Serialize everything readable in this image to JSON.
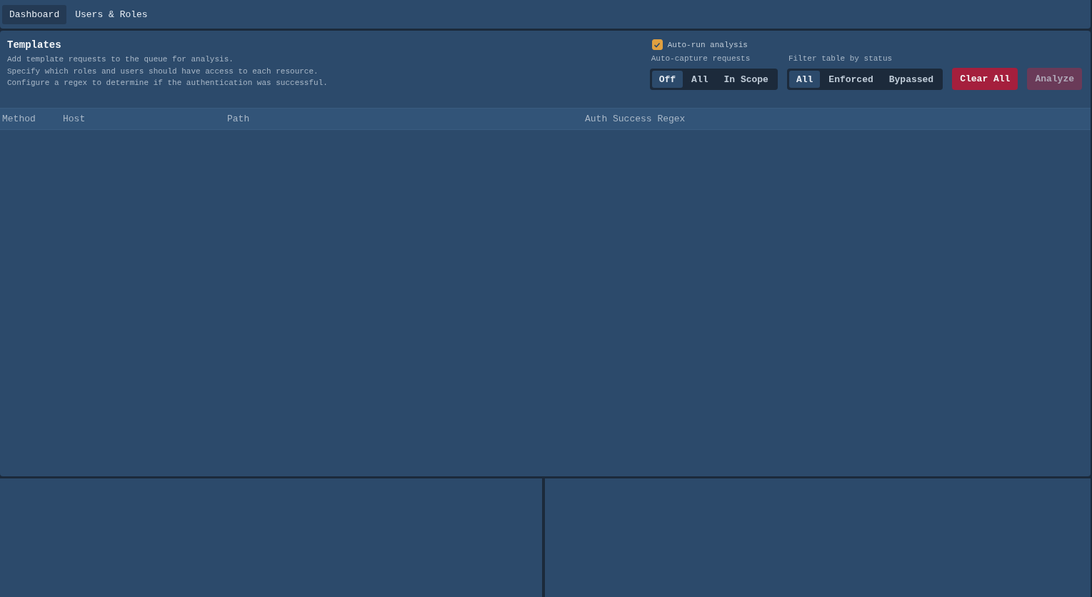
{
  "tabs": [
    {
      "label": "Dashboard",
      "selected": true
    },
    {
      "label": "Users & Roles",
      "selected": false
    }
  ],
  "templates": {
    "title": "Templates",
    "description": [
      "Add template requests to the queue for analysis.",
      "Specify which roles and users should have access to each resource.",
      "Configure a regex to determine if the authentication was successful."
    ],
    "auto_run": {
      "label": "Auto-run analysis",
      "checked": true
    },
    "auto_capture": {
      "label": "Auto-capture requests",
      "options": [
        {
          "label": "Off",
          "selected": true
        },
        {
          "label": "All",
          "selected": false
        },
        {
          "label": "In Scope",
          "selected": false
        }
      ]
    },
    "filter": {
      "label": "Filter table by status",
      "options": [
        {
          "label": "All",
          "selected": true
        },
        {
          "label": "Enforced",
          "selected": false
        },
        {
          "label": "Bypassed",
          "selected": false
        }
      ]
    },
    "buttons": [
      {
        "label": "Clear All",
        "kind": "danger",
        "disabled": false
      },
      {
        "label": "Analyze",
        "kind": "primary",
        "disabled": true
      }
    ]
  },
  "table": {
    "columns": [
      "Method",
      "Host",
      "Path",
      "Auth Success Regex"
    ]
  }
}
